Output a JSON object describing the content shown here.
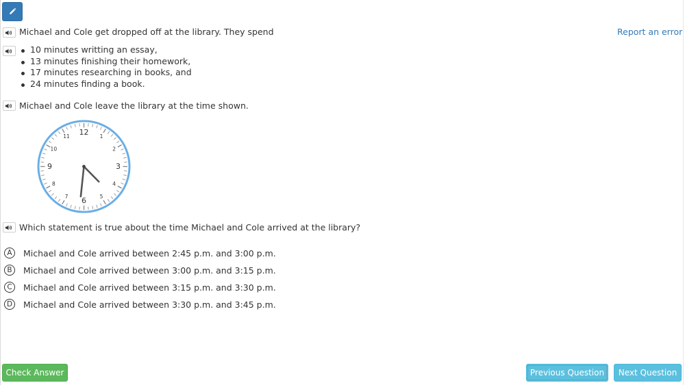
{
  "toolbar": {
    "edit_icon": "pencil-icon",
    "accent_color": "#337ab7"
  },
  "header": {
    "report_link": "Report an error"
  },
  "question": {
    "intro": "Michael and Cole get dropped off at the library. They spend",
    "activities": [
      "10 minutes writting an essay,",
      "13 minutes finishing their homework,",
      "17 minutes researching in books, and",
      "24 minutes finding a book."
    ],
    "leave_text": "Michael and Cole leave the library at the time shown.",
    "prompt": "Which statement is true about the time Michael and Cole arrived at the library?"
  },
  "clock": {
    "numbers": [
      "12",
      "1",
      "2",
      "3",
      "4",
      "5",
      "6",
      "7",
      "8",
      "9",
      "10",
      "11"
    ],
    "time_shown": {
      "hour": 4,
      "minute": 31
    },
    "rim_color": "#6aaee6"
  },
  "options": [
    {
      "letter": "A",
      "text": "Michael and Cole arrived between 2:45 p.m. and 3:00 p.m."
    },
    {
      "letter": "B",
      "text": "Michael and Cole arrived between 3:00 p.m. and 3:15 p.m."
    },
    {
      "letter": "C",
      "text": "Michael and Cole arrived between 3:15 p.m. and 3:30 p.m."
    },
    {
      "letter": "D",
      "text": "Michael and Cole arrived between 3:30 p.m. and 3:45 p.m."
    }
  ],
  "footer": {
    "check_answer": "Check Answer",
    "previous_question": "Previous Question",
    "next_question": "Next Question"
  }
}
